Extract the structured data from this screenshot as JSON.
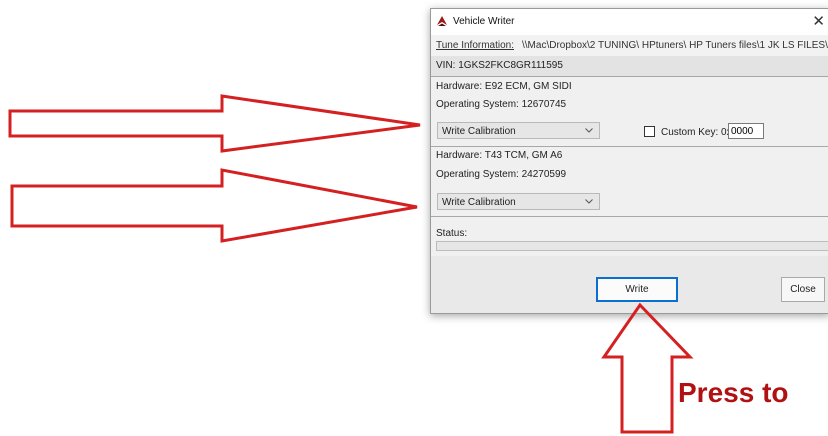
{
  "window": {
    "title": "Vehicle Writer",
    "close_glyph": "✕",
    "icon": "hp-tuners-logo-icon"
  },
  "tune": {
    "label": "Tune Information:",
    "path": "\\\\Mac\\Dropbox\\2 TUNING\\ HPtuners\\ HP Tuners files\\1 JK LS FILES\\"
  },
  "vin": "VIN: 1GKS2FKC8GR111595",
  "module1": {
    "hardware": "Hardware: E92 ECM, GM SIDI",
    "os": "Operating System: 12670745",
    "dropdown_value": "Write Calibration",
    "custom_key_label": "Custom Key: 0x",
    "custom_key_value": "0000",
    "custom_key_checked": false
  },
  "module2": {
    "hardware": "Hardware: T43 TCM, GM A6",
    "os": "Operating System: 24270599",
    "dropdown_value": "Write Calibration"
  },
  "status": {
    "label": "Status:",
    "progress": 0
  },
  "buttons": {
    "write": "Write",
    "close": "Close"
  },
  "annotation": {
    "callout": "Press to",
    "arrow_color": "#d42020",
    "text_color": "#b01212",
    "arrow_icons": [
      "right-arrow-icon",
      "right-arrow-icon",
      "up-arrow-icon"
    ]
  }
}
